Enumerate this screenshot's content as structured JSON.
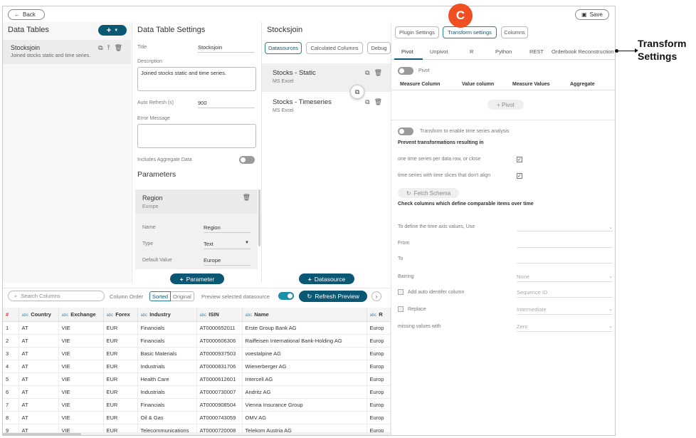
{
  "header": {
    "back_label": "Back",
    "save_label": "Save"
  },
  "data_tables": {
    "title": "Data Tables",
    "add_label": "+",
    "item": {
      "name": "Stocksjoin",
      "description": "Joined stocks static and time series."
    }
  },
  "settings": {
    "title": "Data Table Settings",
    "title_label": "Title",
    "title_value": "Stocksjoin",
    "description_label": "Description",
    "description_value": "Joined stocks static and time series.",
    "refresh_label": "Auto Refresh (s)",
    "refresh_value": "900",
    "error_label": "Error Message",
    "error_value": "",
    "aggregate_label": "Includes Aggregate Data",
    "parameters_title": "Parameters",
    "param": {
      "name": "Region",
      "sub": "Europe",
      "name_label": "Name",
      "name_value": "Region",
      "type_label": "Type",
      "type_value": "Text",
      "default_label": "Default Value",
      "default_value": "Europe"
    },
    "add_param_label": "Parameter"
  },
  "stocksjoin": {
    "title": "Stocksjoin",
    "tabs": [
      "Datasources",
      "Calculated Columns",
      "Debug"
    ],
    "datasources": [
      {
        "name": "Stocks - Static",
        "sub": "MS Excel"
      },
      {
        "name": "Stocks - Timeseries",
        "sub": "MS Excel"
      }
    ],
    "add_ds_label": "Datasource"
  },
  "transform": {
    "top_tabs": [
      "Plugin Settings",
      "Transform settings",
      "Columns"
    ],
    "sub_tabs": [
      "Pivot",
      "Unpivot",
      "R",
      "Python",
      "REST",
      "Orderbook Reconstruction"
    ],
    "pivot_label": "Pivot",
    "pivot_cols": [
      "Measure Column",
      "Value column",
      "Measure Values",
      "Aggregate"
    ],
    "add_pivot_label": "+ Pivot",
    "ts_label": "Transform to enable time series analysis",
    "prevent_label": "Prevent transformations resulting in",
    "opt1": "one time series per data row, or close",
    "opt2": "time series with time slices that don't align",
    "fetch_label": "Fetch Schema",
    "check_cols_label": "Check columns which define comparable items over time",
    "time_axis_label": "To define the time axis values, Use",
    "from_label": "From",
    "to_label": "To",
    "barring_label": "Barring",
    "barring_value": "None",
    "auto_id_label": "Add auto identifer column",
    "auto_id_value": "Sequence ID",
    "replace_label": "Replace",
    "replace_value": "Intermediate",
    "missing_label": "missing values with",
    "missing_value": "Zero"
  },
  "preview": {
    "search_placeholder": "Search Columns",
    "col_order_label": "Column Order",
    "sorted_label": "Sorted",
    "original_label": "Original",
    "preview_label": "Preview selected datasource",
    "refresh_label": "Refresh Preview",
    "columns": [
      "#",
      "Country",
      "Exchange",
      "Forex",
      "Industry",
      "ISIN",
      "Name",
      "R"
    ],
    "rows": [
      [
        "1",
        "AT",
        "VIE",
        "EUR",
        "Financials",
        "AT0000652011",
        "Erste Group Bank AG",
        "Europ"
      ],
      [
        "2",
        "AT",
        "VIE",
        "EUR",
        "Financials",
        "AT0000606306",
        "Raiffeisen International Bank-Holding AG",
        "Europ"
      ],
      [
        "3",
        "AT",
        "VIE",
        "EUR",
        "Basic Materials",
        "AT0000937503",
        "voestalpine AG",
        "Europ"
      ],
      [
        "4",
        "AT",
        "VIE",
        "EUR",
        "Industrials",
        "AT0000831706",
        "Wienerberger AG",
        "Europ"
      ],
      [
        "5",
        "AT",
        "VIE",
        "EUR",
        "Health Care",
        "AT0000612601",
        "Intercell AG",
        "Europ"
      ],
      [
        "6",
        "AT",
        "VIE",
        "EUR",
        "Industrials",
        "AT0000730007",
        "Andritz AG",
        "Europ"
      ],
      [
        "7",
        "AT",
        "VIE",
        "EUR",
        "Financials",
        "AT0000908504",
        "Vienna Insurance Group",
        "Europ"
      ],
      [
        "8",
        "AT",
        "VIE",
        "EUR",
        "Oil & Gas",
        "AT0000743059",
        "OMV AG",
        "Europ"
      ],
      [
        "9",
        "AT",
        "VIE",
        "EUR",
        "Telecommunications",
        "AT0000720008",
        "Telekom Austria AG",
        "Europ"
      ]
    ]
  },
  "annotation": {
    "badge": "C",
    "line1": "Transform",
    "line2": "Settings"
  },
  "colors": {
    "accent": "#0a5874",
    "badge": "#f04e23",
    "toggle_on": "#1a8fa8"
  }
}
